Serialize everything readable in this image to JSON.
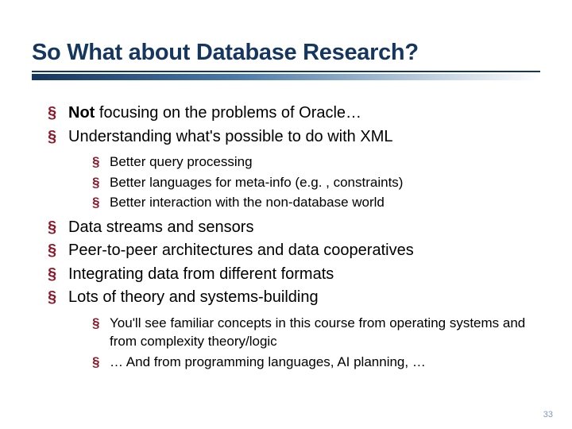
{
  "title": "So What about Database Research?",
  "bullets": {
    "b0_bold": "Not",
    "b0_rest": " focusing on the problems of Oracle…",
    "b1": "Understanding what's possible to do with XML",
    "b1_sub": {
      "s0": "Better query processing",
      "s1": "Better languages for meta-info (e.g. , constraints)",
      "s2": "Better interaction with the non-database world"
    },
    "b2": "Data streams and sensors",
    "b3": "Peer-to-peer architectures and data cooperatives",
    "b4": "Integrating data from different formats",
    "b5": "Lots of theory and systems-building",
    "b5_sub": {
      "s0": "You'll see familiar concepts in this course from operating systems and from complexity theory/logic",
      "s1": "… And from programming languages, AI planning, …"
    }
  },
  "page_number": "33"
}
